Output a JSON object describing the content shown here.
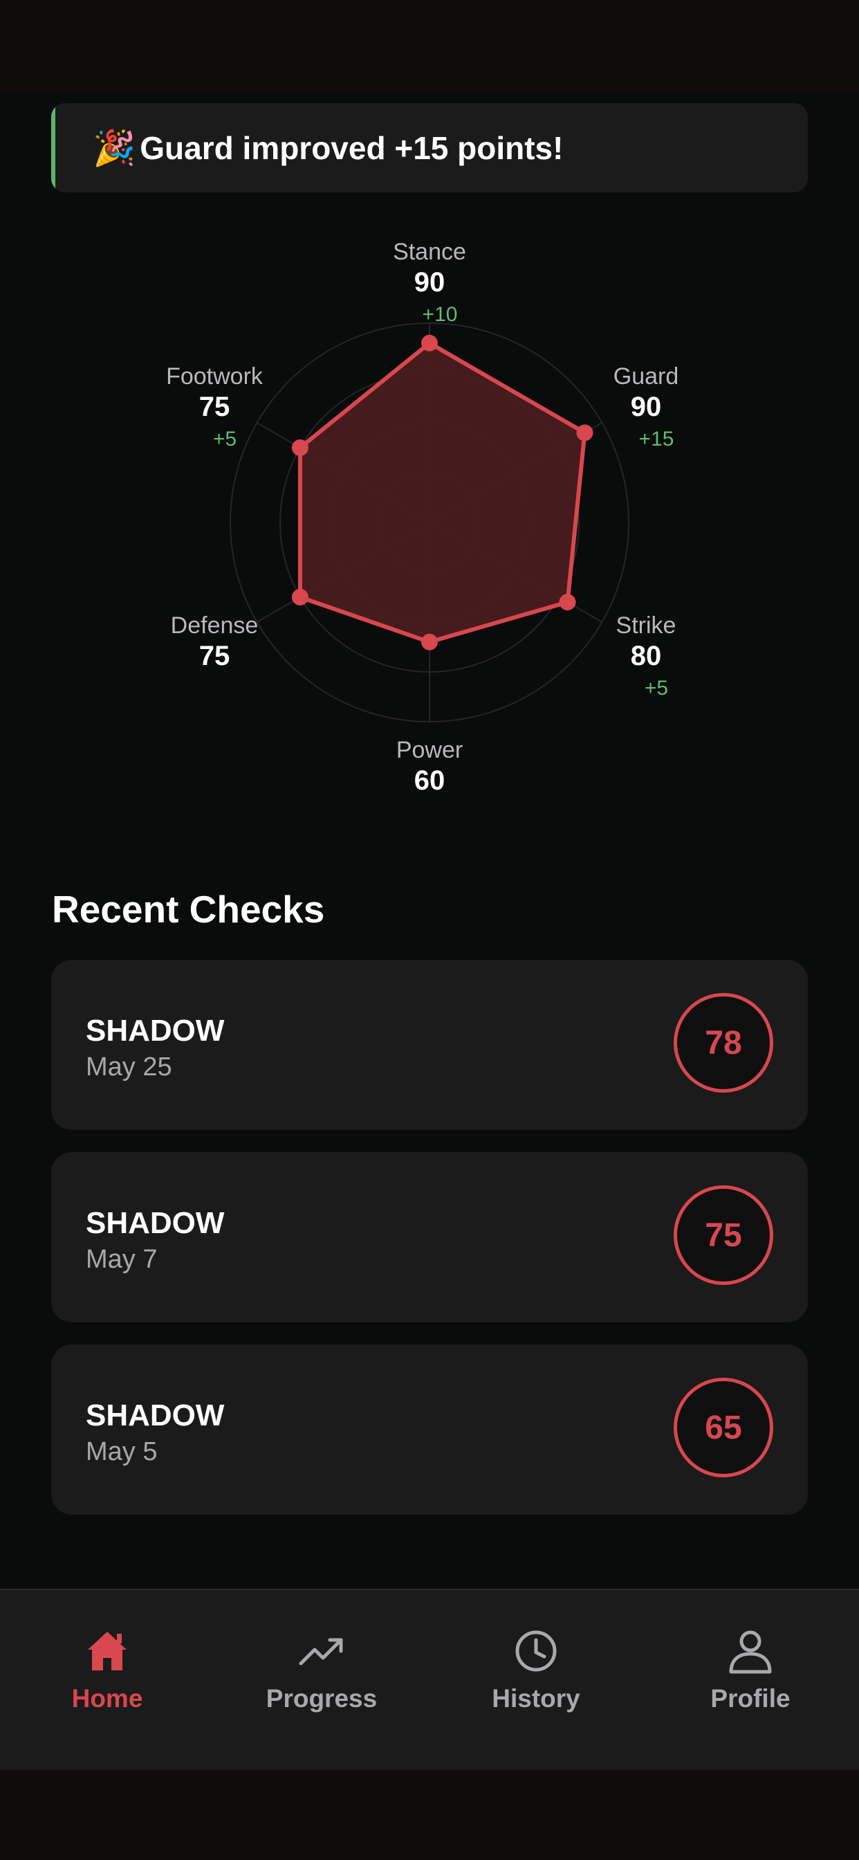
{
  "banner": {
    "icon": "party-popper-icon",
    "text": "Guard improved +15 points!",
    "accent_color": "#5ab86a"
  },
  "chart_data": {
    "type": "radar",
    "axes": [
      {
        "label": "Stance",
        "value": 90,
        "delta": "+10"
      },
      {
        "label": "Guard",
        "value": 90,
        "delta": "+15"
      },
      {
        "label": "Strike",
        "value": 80,
        "delta": "+5"
      },
      {
        "label": "Power",
        "value": 60,
        "delta": ""
      },
      {
        "label": "Defense",
        "value": 75,
        "delta": ""
      },
      {
        "label": "Footwork",
        "value": 75,
        "delta": "+5"
      }
    ],
    "range": [
      0,
      100
    ],
    "grid_rings": 4,
    "fill_color": "#4a1c1f",
    "line_color": "#d9474f",
    "delta_color": "#5fbd70"
  },
  "recent": {
    "title": "Recent Checks",
    "items": [
      {
        "name": "SHADOW",
        "date": "May 25",
        "score": "78"
      },
      {
        "name": "SHADOW",
        "date": "May 7",
        "score": "75"
      },
      {
        "name": "SHADOW",
        "date": "May 5",
        "score": "65"
      }
    ]
  },
  "tabs": [
    {
      "label": "Home",
      "icon": "home-icon",
      "active": true
    },
    {
      "label": "Progress",
      "icon": "trend-up-icon",
      "active": false
    },
    {
      "label": "History",
      "icon": "clock-icon",
      "active": false
    },
    {
      "label": "Profile",
      "icon": "person-icon",
      "active": false
    }
  ],
  "colors": {
    "accent": "#d9474f",
    "background": "#0a0b0b",
    "card": "#1b1b1c"
  }
}
